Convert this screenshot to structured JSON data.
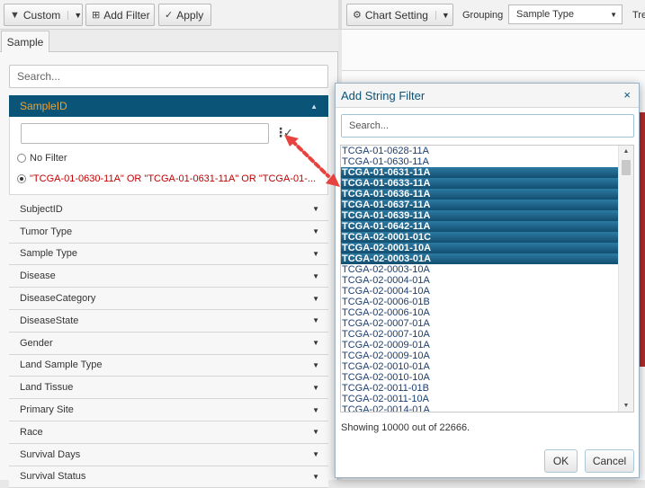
{
  "toolbar": {
    "custom_label": "Custom",
    "add_filter_label": "Add Filter",
    "apply_label": "Apply",
    "chart_setting_label": "Chart Setting",
    "grouping_label": "Grouping",
    "grouping_value": "Sample Type",
    "trend_label": "Tre"
  },
  "left": {
    "tab": "Sample",
    "search_placeholder": "Search...",
    "sample_header": "SampleID",
    "no_filter_label": "No Filter",
    "filter_expression": "\"TCGA-01-0630-11A\" OR \"TCGA-01-0631-11A\" OR \"TCGA-01-...",
    "items": [
      "SubjectID",
      "Tumor Type",
      "Sample Type",
      "Disease",
      "DiseaseCategory",
      "DiseaseState",
      "Gender",
      "Land Sample Type",
      "Land Tissue",
      "Primary Site",
      "Race",
      "Survival Days",
      "Survival Status"
    ]
  },
  "dialog": {
    "title": "Add String Filter",
    "close": "×",
    "search_placeholder": "Search...",
    "items": [
      {
        "label": "TCGA-01-0628-11A",
        "selected": false
      },
      {
        "label": "TCGA-01-0630-11A",
        "selected": false
      },
      {
        "label": "TCGA-01-0631-11A",
        "selected": true
      },
      {
        "label": "TCGA-01-0633-11A",
        "selected": true
      },
      {
        "label": "TCGA-01-0636-11A",
        "selected": true
      },
      {
        "label": "TCGA-01-0637-11A",
        "selected": true
      },
      {
        "label": "TCGA-01-0639-11A",
        "selected": true
      },
      {
        "label": "TCGA-01-0642-11A",
        "selected": true
      },
      {
        "label": "TCGA-02-0001-01C",
        "selected": true
      },
      {
        "label": "TCGA-02-0001-10A",
        "selected": true
      },
      {
        "label": "TCGA-02-0003-01A",
        "selected": true
      },
      {
        "label": "TCGA-02-0003-10A",
        "selected": false
      },
      {
        "label": "TCGA-02-0004-01A",
        "selected": false
      },
      {
        "label": "TCGA-02-0004-10A",
        "selected": false
      },
      {
        "label": "TCGA-02-0006-01B",
        "selected": false
      },
      {
        "label": "TCGA-02-0006-10A",
        "selected": false
      },
      {
        "label": "TCGA-02-0007-01A",
        "selected": false
      },
      {
        "label": "TCGA-02-0007-10A",
        "selected": false
      },
      {
        "label": "TCGA-02-0009-01A",
        "selected": false
      },
      {
        "label": "TCGA-02-0009-10A",
        "selected": false
      },
      {
        "label": "TCGA-02-0010-01A",
        "selected": false
      },
      {
        "label": "TCGA-02-0010-10A",
        "selected": false
      },
      {
        "label": "TCGA-02-0011-01B",
        "selected": false
      },
      {
        "label": "TCGA-02-0011-10A",
        "selected": false
      },
      {
        "label": "TCGA-02-0014-01A",
        "selected": false
      }
    ],
    "showing_text": "Showing 10000 out of 22666.",
    "ok_label": "OK",
    "cancel_label": "Cancel"
  },
  "colors": {
    "header_bg": "#0a5477",
    "header_text": "#f0a030",
    "selected_bg": "#1b5f85",
    "filter_text": "#c00000",
    "annotation_arrow": "#e8423f"
  }
}
